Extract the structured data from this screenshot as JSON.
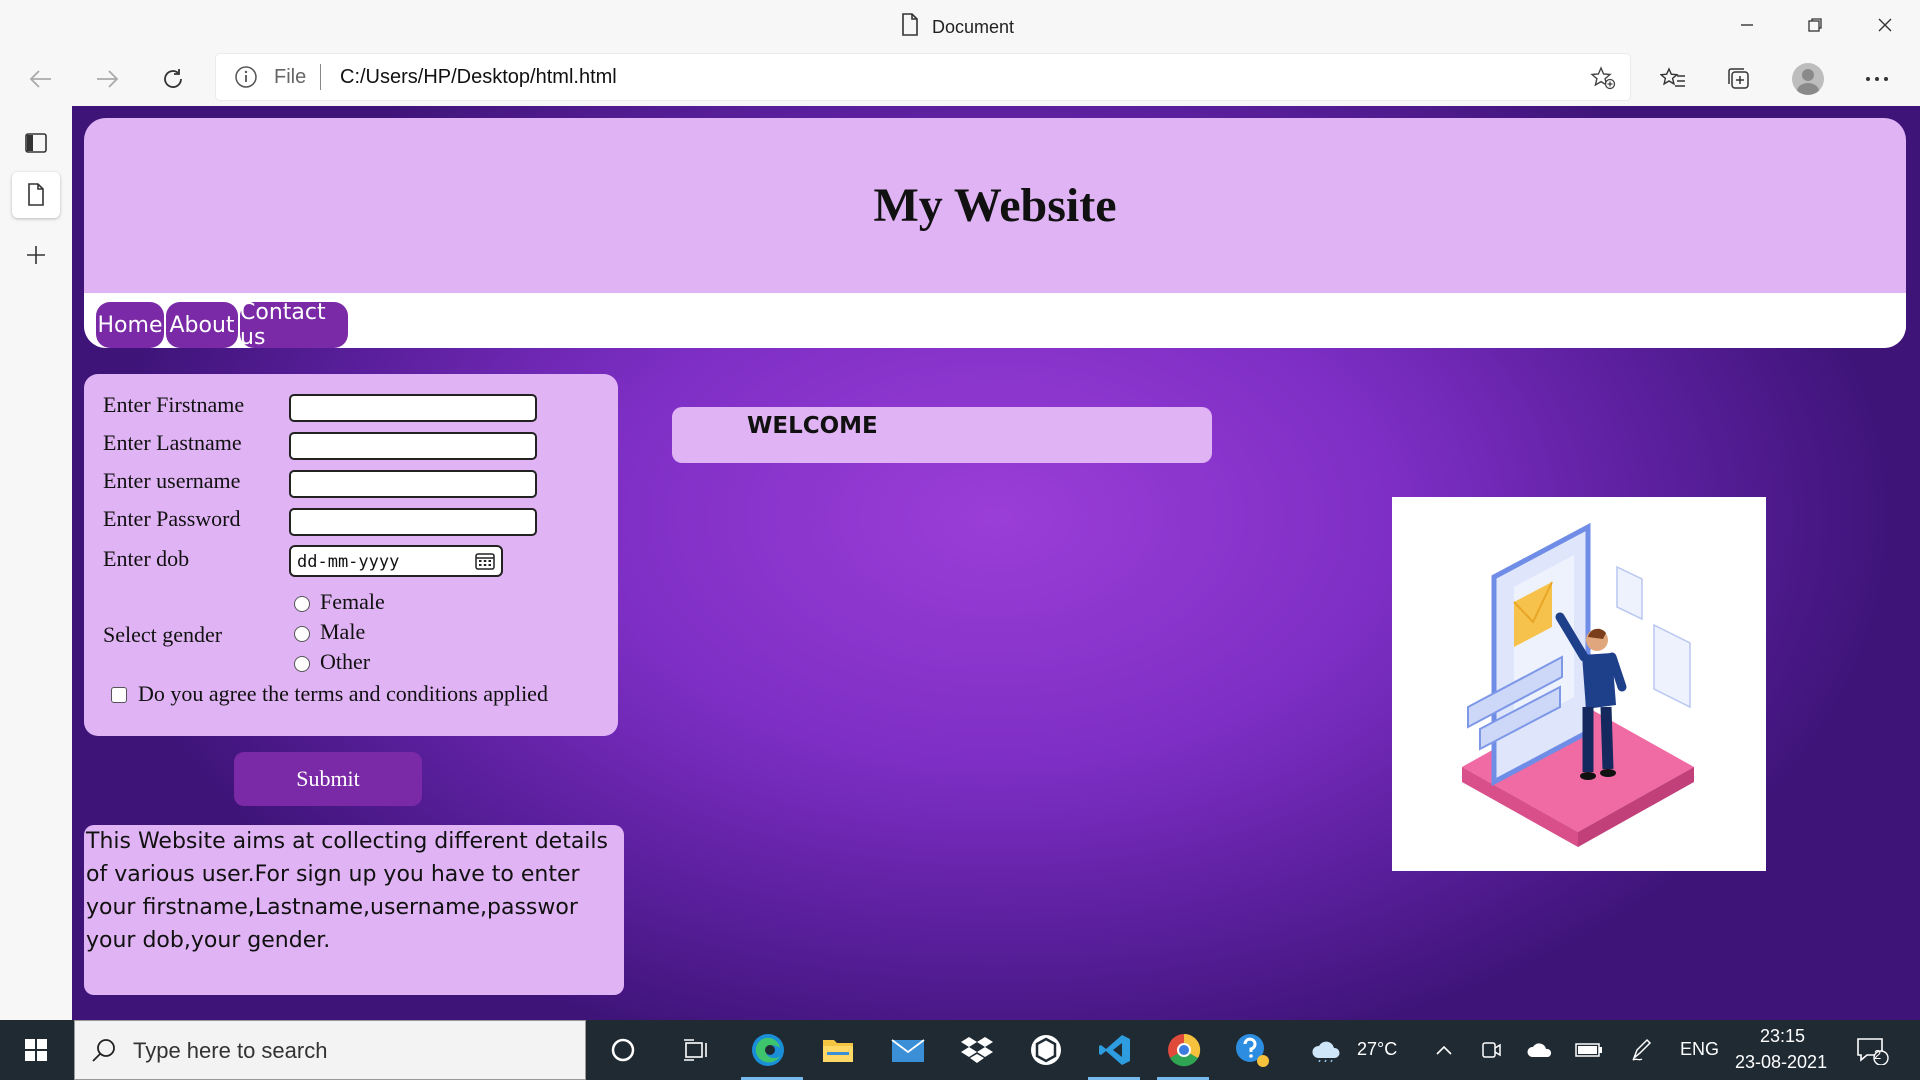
{
  "browser": {
    "tab_title": "Document",
    "address": {
      "scheme_label": "File",
      "url": "C:/Users/HP/Desktop/html.html"
    }
  },
  "page": {
    "site_title": "My Website",
    "nav": [
      "Home",
      "About",
      "Contact us"
    ],
    "form": {
      "firstname_label": "Enter Firstname",
      "lastname_label": "Enter Lastname",
      "username_label": "Enter username",
      "password_label": "Enter Password",
      "dob_label": "Enter dob",
      "dob_placeholder": "dd-mm-yyyy",
      "gender_label": "Select gender",
      "gender_options": [
        "Female",
        "Male",
        "Other"
      ],
      "terms_label": "Do you agree the terms and conditions applied",
      "submit_label": "Submit"
    },
    "info_text": "This Website aims at collecting different details of various user.For sign up you have to enter your firstname,Lastname,username,passwor your dob,your gender.",
    "welcome_text": "WELCOME",
    "colors": {
      "panel": "#e0b4f4",
      "button": "#7a2aa6",
      "background": "#8a35cc"
    }
  },
  "taskbar": {
    "search_placeholder": "Type here to search",
    "weather": "27°C",
    "language": "ENG",
    "time": "23:15",
    "date": "23-08-2021",
    "notification_count": "2"
  }
}
